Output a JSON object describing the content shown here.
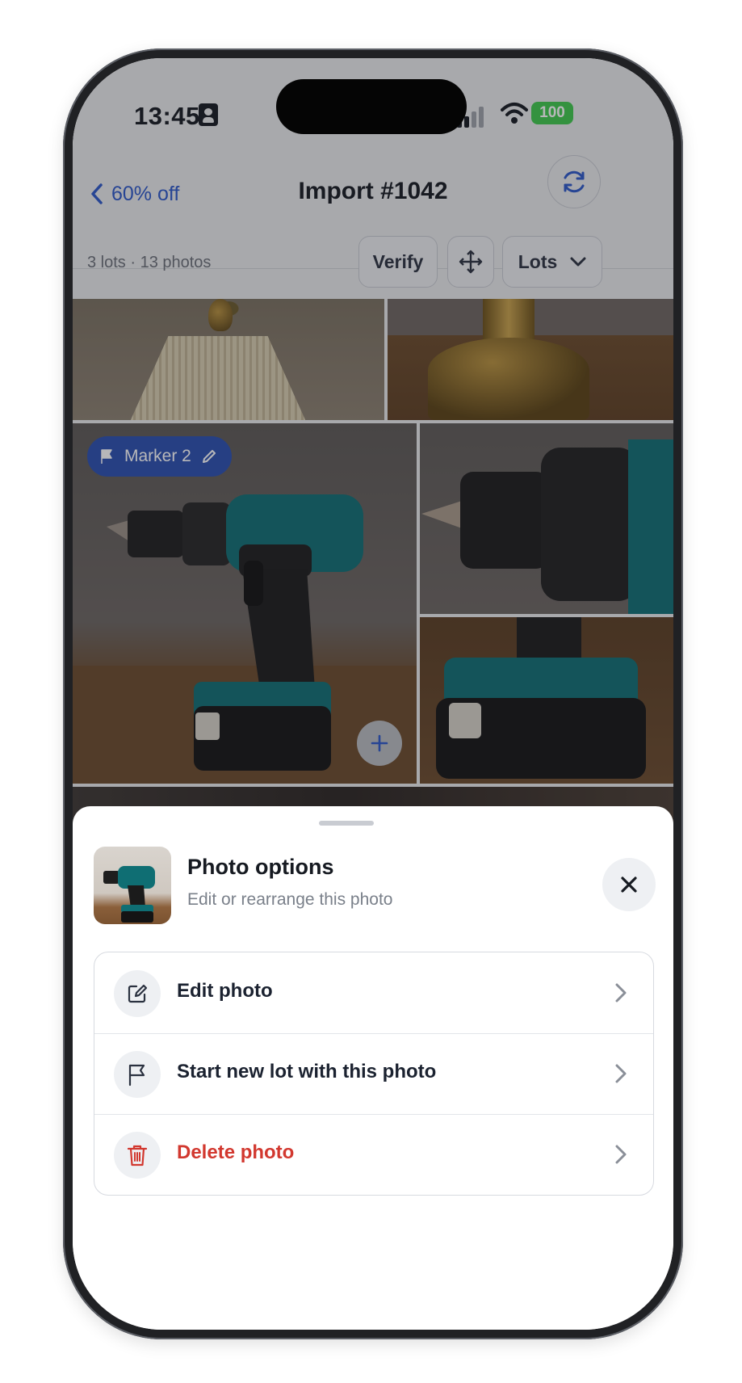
{
  "status_bar": {
    "time": "13:45",
    "battery": "100"
  },
  "nav": {
    "back_label": "60% off",
    "title": "Import #1042"
  },
  "toolbar": {
    "summary": "3 lots · 13 photos",
    "verify_label": "Verify",
    "lots_label": "Lots"
  },
  "grid": {
    "marker_label": "Marker 2"
  },
  "sheet": {
    "title": "Photo options",
    "subtitle": "Edit or rearrange this photo",
    "items": [
      {
        "label": "Edit photo",
        "icon": "edit-icon"
      },
      {
        "label": "Start new lot with this photo",
        "icon": "flag-icon"
      },
      {
        "label": "Delete photo",
        "icon": "trash-icon",
        "color": "#d2382f"
      }
    ]
  },
  "colors": {
    "accent": "#2c57c9",
    "marker": "#2a4fb0",
    "danger": "#d2382f",
    "battery": "#3ec94c"
  }
}
